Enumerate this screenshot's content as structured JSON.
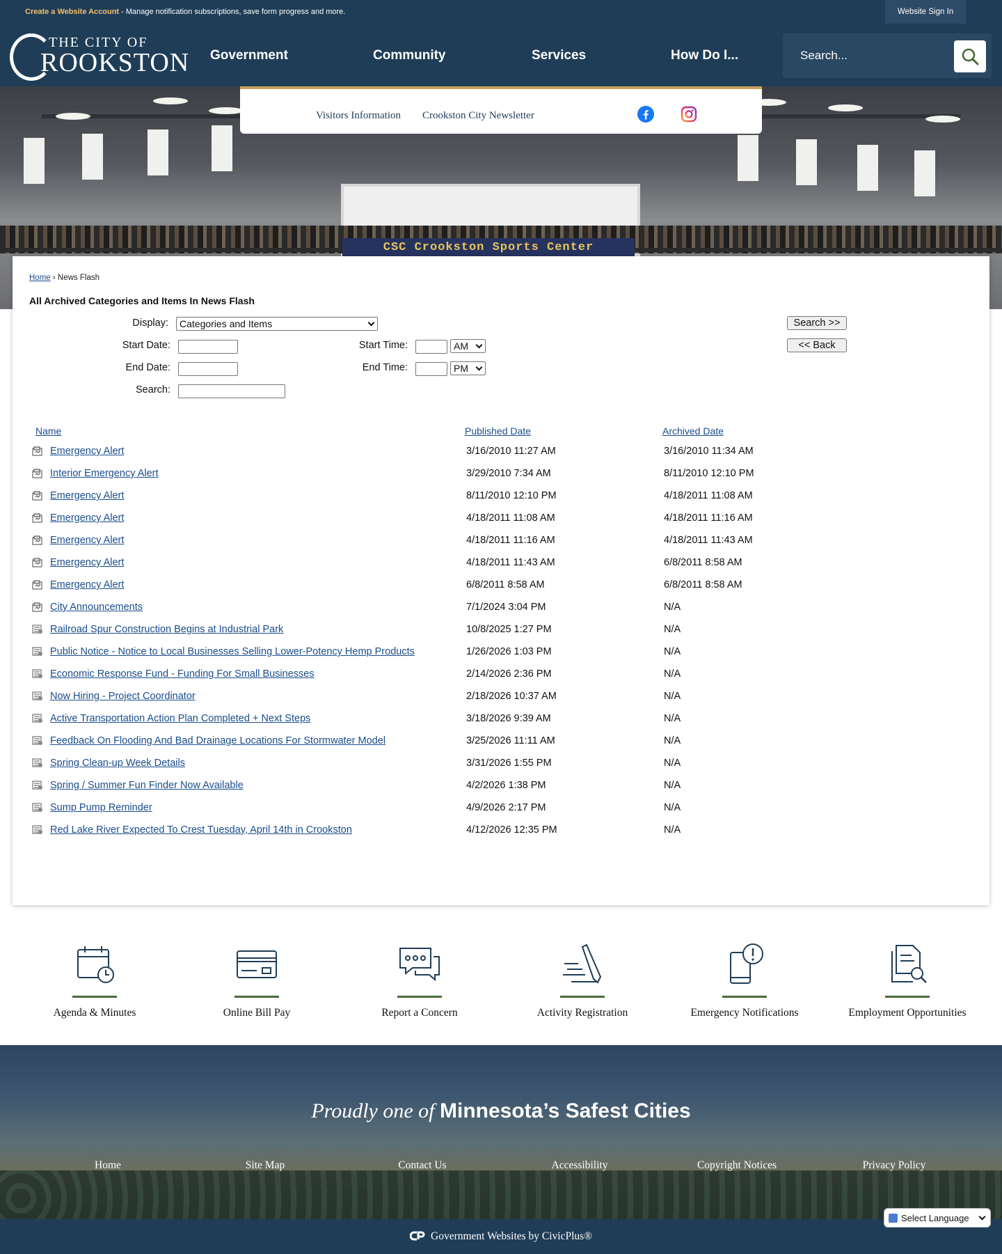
{
  "topbar": {
    "account_link": "Create a Website Account",
    "account_text": " - Manage notification subscriptions, save form progress and more.",
    "sign_in": "Website Sign In"
  },
  "logo": {
    "line1": "THE CITY OF",
    "line2": "ROOKSTON"
  },
  "nav": {
    "items": [
      "Government",
      "Community",
      "Services",
      "How Do I..."
    ]
  },
  "search": {
    "placeholder": "Search..."
  },
  "subnav": {
    "links": [
      "Visitors Information",
      "Crookston City Newsletter"
    ]
  },
  "hero": {
    "sign_text": "CSC  Crookston Sports Center"
  },
  "breadcrumb": {
    "home": "Home",
    "separator": " › ",
    "current": "News Flash"
  },
  "page_title": "All Archived Categories and Items In News Flash",
  "form": {
    "display_label": "Display:",
    "display_value": "Categories and Items",
    "start_date_label": "Start Date:",
    "end_date_label": "End Date:",
    "search_label": "Search:",
    "start_time_label": "Start Time:",
    "end_time_label": "End Time:",
    "start_ampm": "AM",
    "end_ampm": "PM",
    "search_button": "Search >>",
    "back_button": "<< Back"
  },
  "table": {
    "headers": {
      "name": "Name",
      "published": "Published Date",
      "archived": "Archived Date"
    },
    "rows": [
      {
        "name": "Emergency Alert",
        "published": "3/16/2010 11:27 AM",
        "archived": "3/16/2010 11:34 AM",
        "icon": "category-icon"
      },
      {
        "name": "Interior Emergency Alert",
        "published": "3/29/2010 7:34 AM",
        "archived": "8/11/2010 12:10 PM",
        "icon": "category-icon"
      },
      {
        "name": "Emergency Alert",
        "published": "8/11/2010 12:10 PM",
        "archived": "4/18/2011 11:08 AM",
        "icon": "category-icon"
      },
      {
        "name": "Emergency Alert",
        "published": "4/18/2011 11:08 AM",
        "archived": "4/18/2011 11:16 AM",
        "icon": "category-icon"
      },
      {
        "name": "Emergency Alert",
        "published": "4/18/2011 11:16 AM",
        "archived": "4/18/2011 11:43 AM",
        "icon": "category-icon"
      },
      {
        "name": "Emergency Alert",
        "published": "4/18/2011 11:43 AM",
        "archived": "6/8/2011 8:58 AM",
        "icon": "category-icon"
      },
      {
        "name": "Emergency Alert",
        "published": "6/8/2011 8:58 AM",
        "archived": "6/8/2011 8:58 AM",
        "icon": "category-icon"
      },
      {
        "name": "City Announcements",
        "published": "7/1/2024 3:04 PM",
        "archived": "N/A",
        "icon": "category-icon"
      },
      {
        "name": "Railroad Spur Construction Begins at Industrial Park",
        "published": "10/8/2025 1:27 PM",
        "archived": "N/A",
        "icon": "item-icon"
      },
      {
        "name": "Public Notice - Notice to Local Businesses Selling Lower-Potency Hemp Products",
        "published": "1/26/2026 1:03 PM",
        "archived": "N/A",
        "icon": "item-icon"
      },
      {
        "name": "Economic Response Fund - Funding For Small Businesses",
        "published": "2/14/2026 2:36 PM",
        "archived": "N/A",
        "icon": "item-icon"
      },
      {
        "name": "Now Hiring - Project Coordinator",
        "published": "2/18/2026 10:37 AM",
        "archived": "N/A",
        "icon": "item-icon"
      },
      {
        "name": "Active Transportation Action Plan Completed + Next Steps",
        "published": "3/18/2026 9:39 AM",
        "archived": "N/A",
        "icon": "item-icon"
      },
      {
        "name": "Feedback On Flooding And Bad Drainage Locations For Stormwater Model",
        "published": "3/25/2026 11:11 AM",
        "archived": "N/A",
        "icon": "item-icon"
      },
      {
        "name": "Spring Clean-up Week Details",
        "published": "3/31/2026 1:55 PM",
        "archived": "N/A",
        "icon": "item-icon"
      },
      {
        "name": "Spring / Summer Fun Finder Now Available",
        "published": "4/2/2026 1:38 PM",
        "archived": "N/A",
        "icon": "item-icon"
      },
      {
        "name": "Sump Pump Reminder",
        "published": "4/9/2026 2:17 PM",
        "archived": "N/A",
        "icon": "item-icon"
      },
      {
        "name": "Red Lake River Expected To Crest Tuesday, April 14th in Crookston",
        "published": "4/12/2026 12:35 PM",
        "archived": "N/A",
        "icon": "item-icon"
      }
    ]
  },
  "quick_links": [
    {
      "label": "Agenda & Minutes",
      "icon": "calendar-clock-icon"
    },
    {
      "label": "Online Bill Pay",
      "icon": "credit-card-icon"
    },
    {
      "label": "Report a Concern",
      "icon": "chat-bubbles-icon"
    },
    {
      "label": "Activity Registration",
      "icon": "pen-paper-icon"
    },
    {
      "label": "Emergency Notifications",
      "icon": "phone-alert-icon"
    },
    {
      "label": "Employment Opportunities",
      "icon": "document-search-icon"
    }
  ],
  "footer": {
    "tagline_italic": "Proudly one of ",
    "tagline_bold": "Minnesota’s Safest Cities",
    "links": [
      "Home",
      "Site Map",
      "Contact Us",
      "Accessibility",
      "Copyright Notices",
      "Privacy Policy"
    ],
    "civicplus": "Government Websites by CivicPlus®",
    "language": "Select Language"
  },
  "colors": {
    "navy": "#1f3d57",
    "gold": "#c8a259",
    "link_blue": "#1a4d8c",
    "accent_green": "#4a6b3a"
  }
}
